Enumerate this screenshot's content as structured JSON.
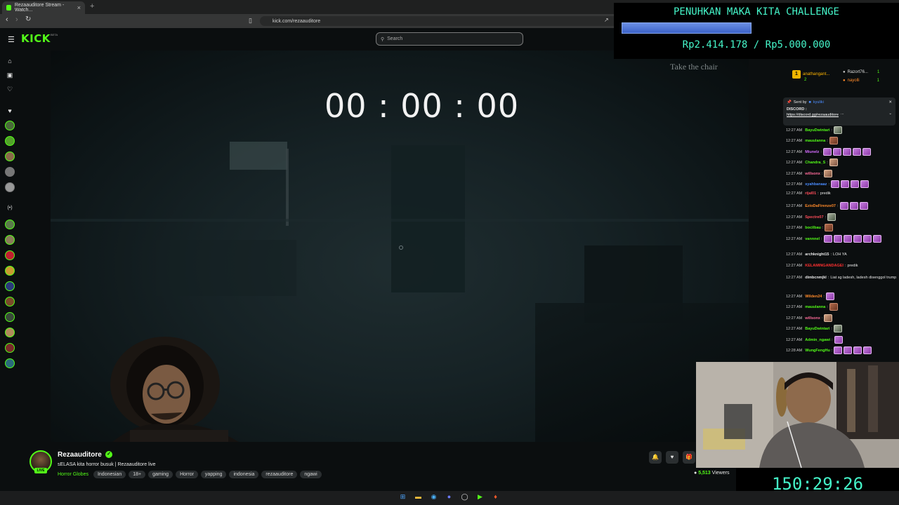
{
  "browser": {
    "tab_title": "Rezaauditore Stream - Watch...",
    "tab_close": "×",
    "new_tab": "+",
    "url": "kick.com/rezaauditore"
  },
  "header": {
    "logo": "KICK",
    "beta": "BETA",
    "search_placeholder": "Search"
  },
  "video": {
    "timer": "00 : 00 : 00",
    "overlay_text": "Take the chair"
  },
  "stream": {
    "streamer": "Rezaauditore",
    "live_label": "LIVE",
    "title": "sELASA kita horror busuk | Rezaauditore live",
    "category": "Horror Globes",
    "tags": [
      "Indonesian",
      "18+",
      "gaming",
      "Horror",
      "yapping",
      "indonesia",
      "rezaauditore",
      "ngawi"
    ],
    "viewers_count": "5,513",
    "viewers_label": "Viewers"
  },
  "challenge": {
    "title": "PENUHKAN MAKA KITA CHALLENGE",
    "amount": "Rp2.414.178 / Rp5.000.000",
    "progress": 0.4828
  },
  "countdown": "150:29:26",
  "chat": {
    "gift_leaders": [
      {
        "name": "anathangant...",
        "count": "2"
      },
      {
        "name": "Razort76...",
        "count": "1"
      },
      {
        "name": "nayolli",
        "count": "1"
      }
    ],
    "pinned": {
      "sent_by": "Sent by",
      "user": "kyuliki",
      "label": "DISCORD :",
      "link": "https://discord.gg/rezaauditore",
      "more": "..."
    },
    "messages": [
      {
        "time": "12:27 AM",
        "user": "BayuDwintari",
        "color": "#53fc18",
        "text": "",
        "emotes": [
          "grey"
        ]
      },
      {
        "time": "12:27 AM",
        "user": "mauulanna",
        "color": "#53fc18",
        "text": "",
        "emotes": [
          "brown"
        ]
      },
      {
        "time": "12:27 AM",
        "user": "Miunelz",
        "color": "#d56cff",
        "text": "",
        "emotes": [
          "p",
          "p",
          "p",
          "p",
          "p"
        ]
      },
      {
        "time": "12:27 AM",
        "user": "Chandra_S",
        "color": "#53fc18",
        "text": "",
        "emotes": [
          "tan"
        ]
      },
      {
        "time": "12:27 AM",
        "user": "willsonx",
        "color": "#ff6b9a",
        "text": "",
        "emotes": [
          "tan"
        ]
      },
      {
        "time": "12:27 AM",
        "user": "syahbanaaz",
        "color": "#4a8cff",
        "text": "",
        "emotes": [
          "p",
          "p",
          "p",
          "p"
        ]
      },
      {
        "time": "12:27 AM",
        "user": "rijal01",
        "color": "#ff4d5a",
        "text": "predik",
        "emotes": []
      },
      {
        "time": "12:27 AM",
        "user": "EzioDaFirenze07",
        "color": "#ff8a2a",
        "text": "",
        "emotes": [
          "p",
          "p",
          "p"
        ]
      },
      {
        "time": "12:27 AM",
        "user": "Spectre07",
        "color": "#ff4d5a",
        "text": "",
        "emotes": [
          "grey"
        ]
      },
      {
        "time": "12:27 AM",
        "user": "bocilbau",
        "color": "#53fc18",
        "text": "",
        "emotes": [
          "brown"
        ]
      },
      {
        "time": "12:27 AM",
        "user": "vannnel",
        "color": "#53fc18",
        "text": "",
        "emotes": [
          "p",
          "p",
          "p",
          "p",
          "p",
          "p"
        ]
      },
      {
        "time": "12:27 AM",
        "user": "archknight15",
        "color": "#e8e8e8",
        "text": "LOH YA",
        "emotes": []
      },
      {
        "time": "12:27 AM",
        "user": "KELAMINGANDAGEI",
        "color": "#ff3030",
        "text": "predik",
        "emotes": []
      },
      {
        "time": "12:27 AM",
        "user": "dimbcnmjkl",
        "color": "#e8e8e8",
        "text": "Liat sg ladesh, ladesh disenggol trump",
        "emotes": []
      },
      {
        "time": "12:27 AM",
        "user": "Wilden24",
        "color": "#ff8a2a",
        "text": "",
        "emotes": [
          "p"
        ]
      },
      {
        "time": "12:27 AM",
        "user": "mauulanna",
        "color": "#53fc18",
        "text": "",
        "emotes": [
          "brown"
        ]
      },
      {
        "time": "12:27 AM",
        "user": "willsonx",
        "color": "#ff6b9a",
        "text": "",
        "emotes": [
          "tan"
        ]
      },
      {
        "time": "12:27 AM",
        "user": "BayuDwintari",
        "color": "#53fc18",
        "text": "",
        "emotes": [
          "grey"
        ]
      },
      {
        "time": "12:27 AM",
        "user": "Admin_ngawi",
        "color": "#53fc18",
        "text": "",
        "emotes": [
          "p"
        ]
      },
      {
        "time": "12:28 AM",
        "user": "WungFengHu",
        "color": "#53fc18",
        "text": "",
        "emotes": [
          "p",
          "p",
          "p",
          "p"
        ]
      }
    ]
  }
}
